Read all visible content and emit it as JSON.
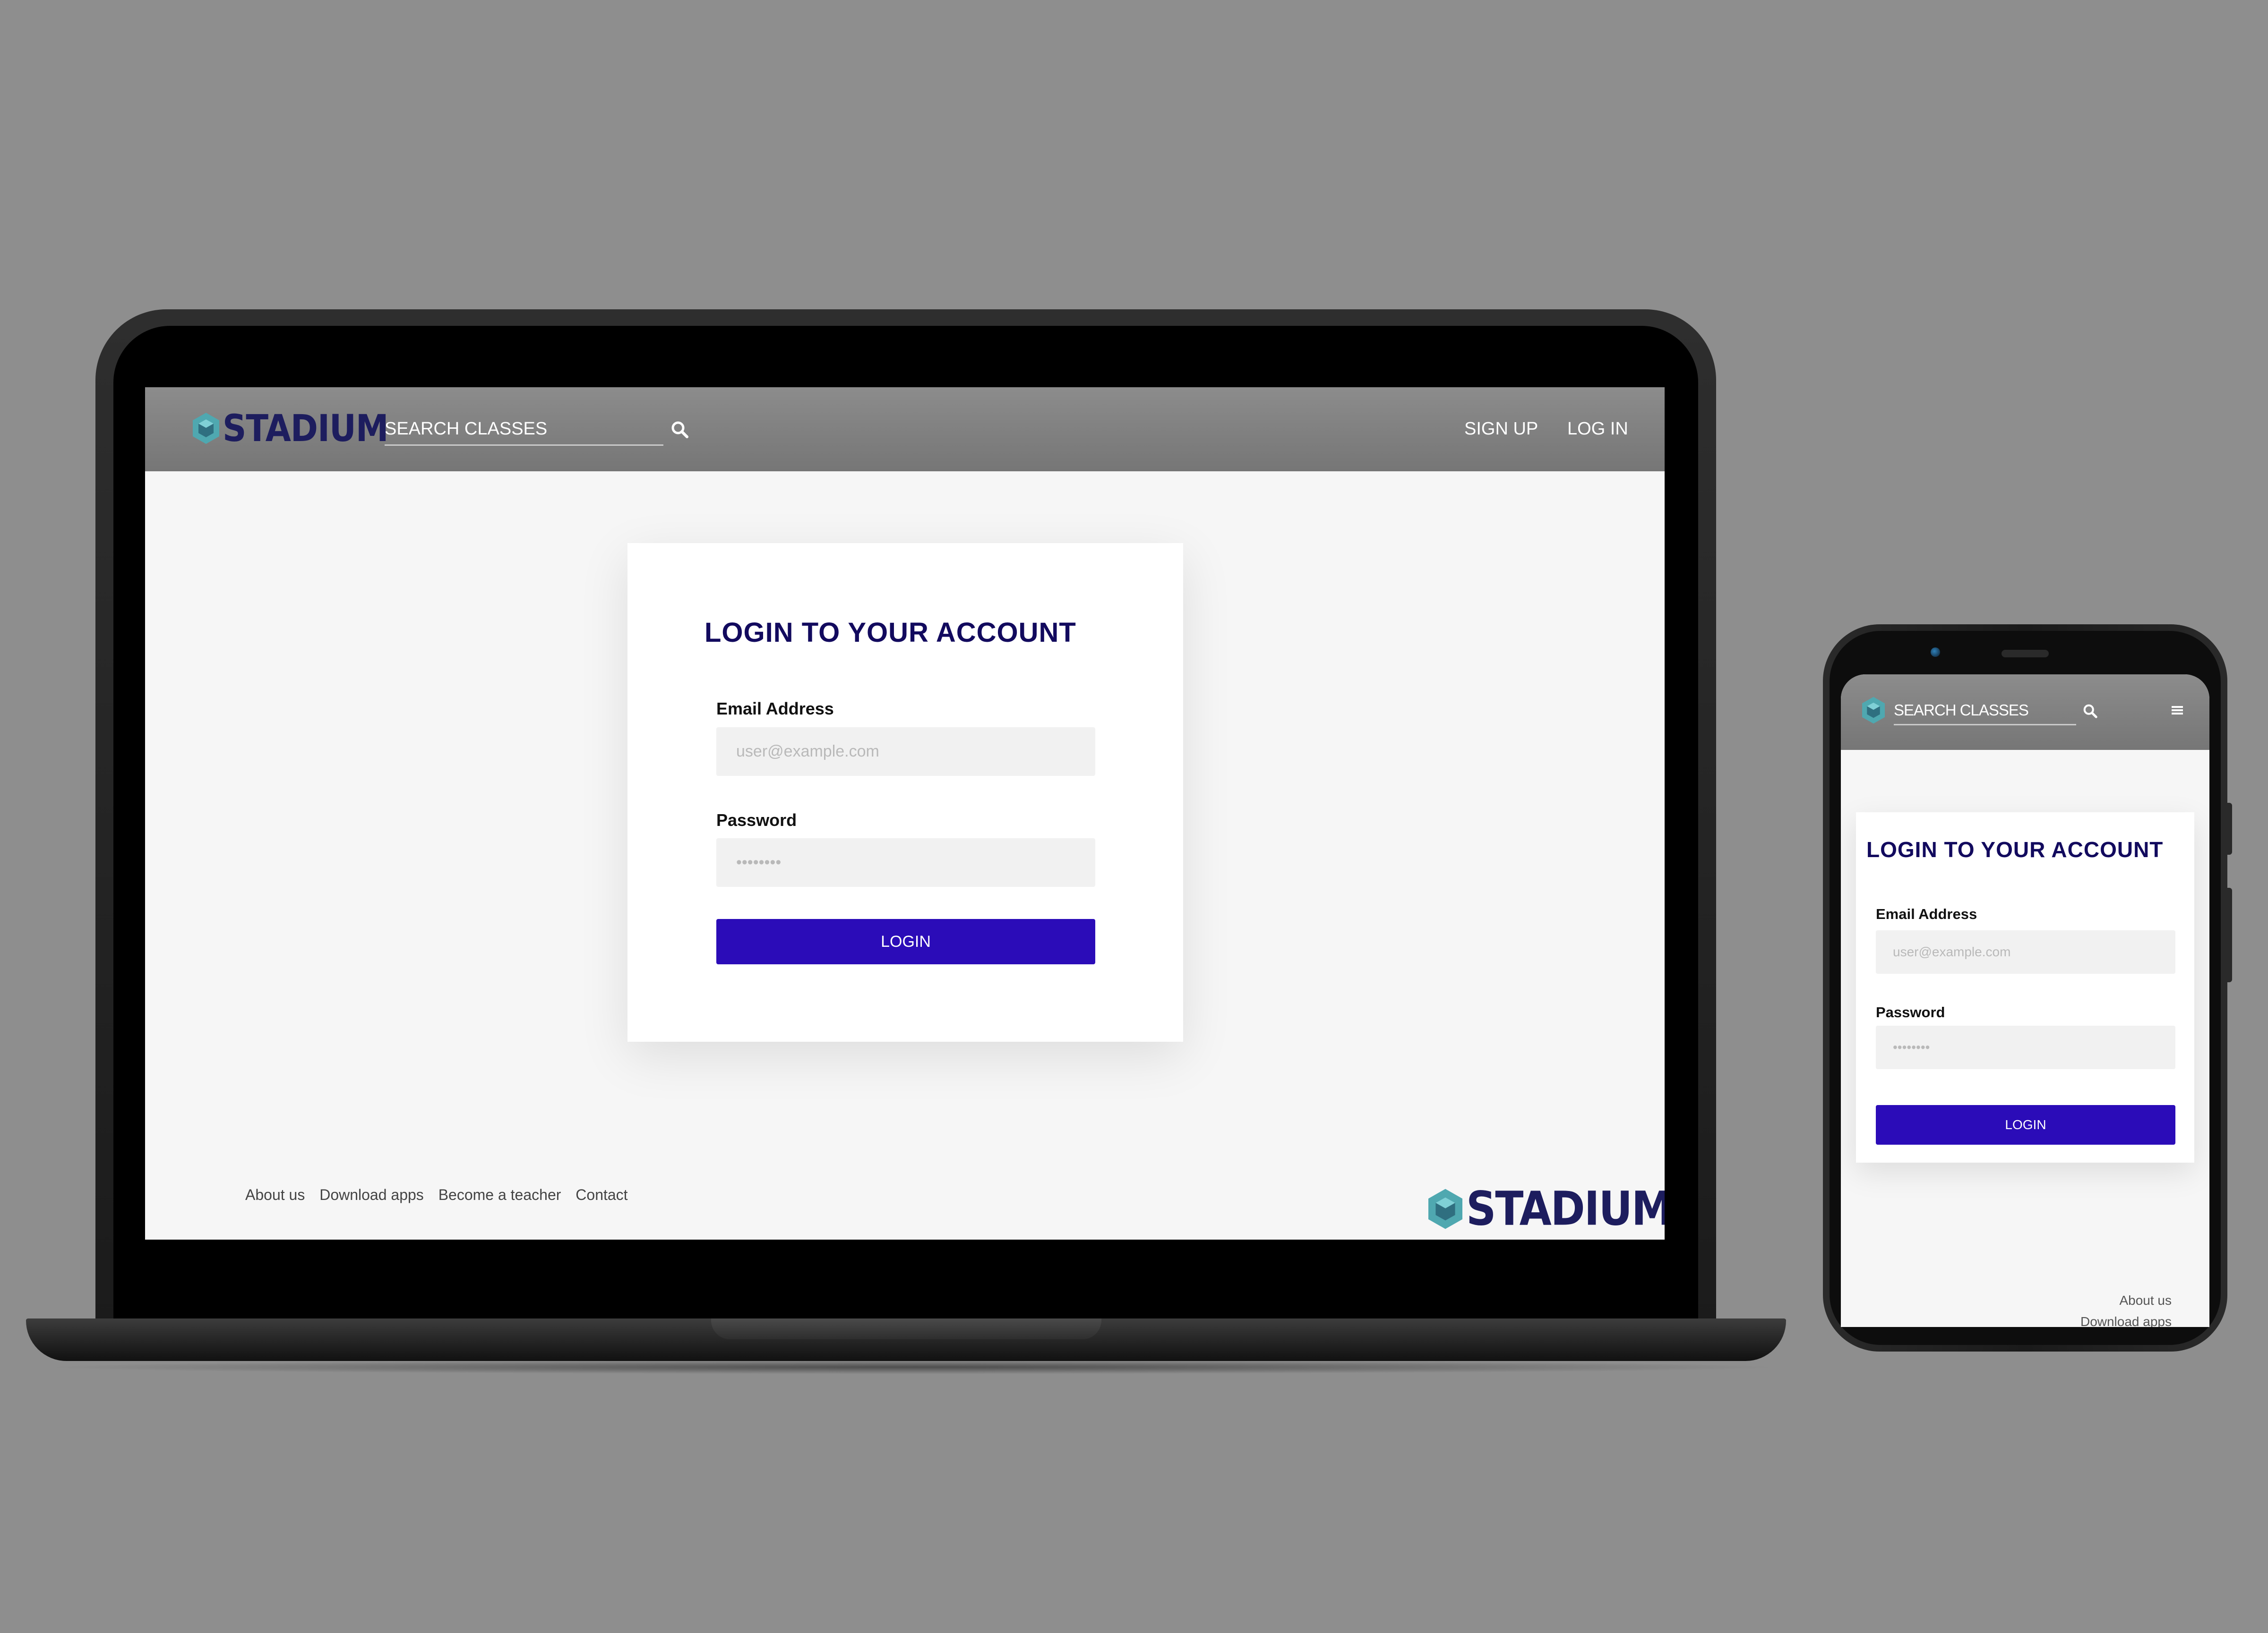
{
  "brand": {
    "name": "STADIUM",
    "primary_color": "#2b0cb8",
    "title_color": "#120a5e",
    "logo_color": "#1d1d5e",
    "logo_accent": "#4fa8b0"
  },
  "desktop": {
    "header": {
      "logo_text": "STADIUM",
      "search_placeholder": "SEARCH CLASSES",
      "search_icon": "search-icon",
      "nav": {
        "signup": "SIGN UP",
        "login": "LOG IN"
      }
    },
    "login_card": {
      "title": "LOGIN TO YOUR ACCOUNT",
      "email_label": "Email Address",
      "email_placeholder": "user@example.com",
      "password_label": "Password",
      "password_placeholder": "••••••••",
      "submit_label": "LOGIN"
    },
    "footer": {
      "links": [
        "About us",
        "Download apps",
        "Become a teacher",
        "Contact"
      ],
      "logo_text": "STADIUM"
    }
  },
  "mobile": {
    "header": {
      "search_placeholder": "SEARCH CLASSES",
      "search_icon": "search-icon",
      "menu_icon": "hamburger-menu-icon"
    },
    "login_card": {
      "title": "LOGIN TO YOUR ACCOUNT",
      "email_label": "Email Address",
      "email_placeholder": "user@example.com",
      "password_label": "Password",
      "password_placeholder": "••••••••",
      "submit_label": "LOGIN"
    },
    "footer": {
      "links": [
        "About us",
        "Download apps"
      ]
    }
  }
}
